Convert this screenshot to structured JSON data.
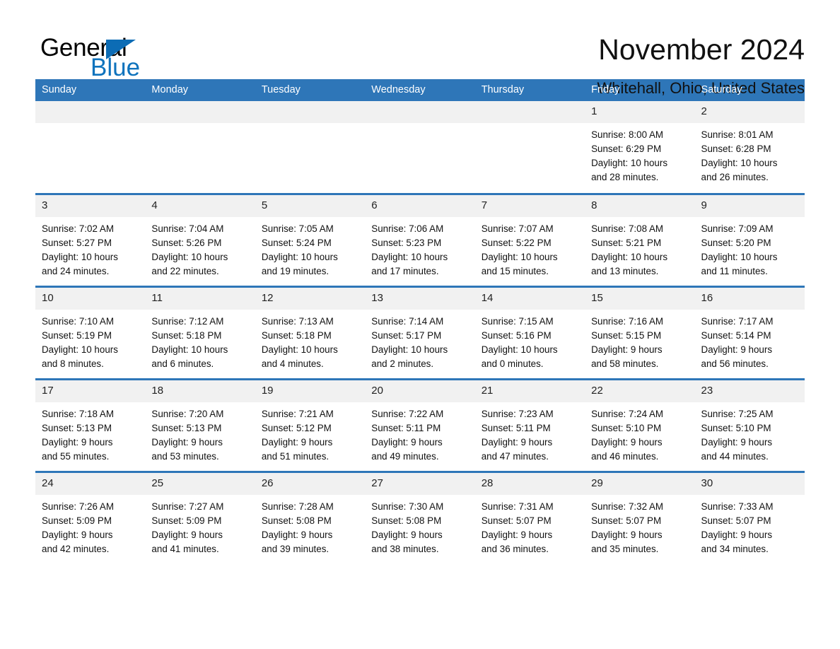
{
  "brand": {
    "name_part1": "General",
    "name_part2": "Blue",
    "triangle_color": "#0c6cb5",
    "blue_color": "#0f73bd"
  },
  "header": {
    "month_title": "November 2024",
    "location": "Whitehall, Ohio, United States"
  },
  "theme": {
    "header_blue": "#2e76b8",
    "daynum_gray": "#f1f1f1"
  },
  "calendar": {
    "weekdays": [
      "Sunday",
      "Monday",
      "Tuesday",
      "Wednesday",
      "Thursday",
      "Friday",
      "Saturday"
    ],
    "labels": {
      "sunrise_prefix": "Sunrise:",
      "sunset_prefix": "Sunset:",
      "daylight_prefix": "Daylight:"
    },
    "weeks": [
      [
        {
          "day": "",
          "empty": true
        },
        {
          "day": "",
          "empty": true
        },
        {
          "day": "",
          "empty": true
        },
        {
          "day": "",
          "empty": true
        },
        {
          "day": "",
          "empty": true
        },
        {
          "day": "1",
          "sunrise": "Sunrise: 8:00 AM",
          "sunset": "Sunset: 6:29 PM",
          "daylight_line1": "Daylight: 10 hours",
          "daylight_line2": "and 28 minutes."
        },
        {
          "day": "2",
          "sunrise": "Sunrise: 8:01 AM",
          "sunset": "Sunset: 6:28 PM",
          "daylight_line1": "Daylight: 10 hours",
          "daylight_line2": "and 26 minutes."
        }
      ],
      [
        {
          "day": "3",
          "sunrise": "Sunrise: 7:02 AM",
          "sunset": "Sunset: 5:27 PM",
          "daylight_line1": "Daylight: 10 hours",
          "daylight_line2": "and 24 minutes."
        },
        {
          "day": "4",
          "sunrise": "Sunrise: 7:04 AM",
          "sunset": "Sunset: 5:26 PM",
          "daylight_line1": "Daylight: 10 hours",
          "daylight_line2": "and 22 minutes."
        },
        {
          "day": "5",
          "sunrise": "Sunrise: 7:05 AM",
          "sunset": "Sunset: 5:24 PM",
          "daylight_line1": "Daylight: 10 hours",
          "daylight_line2": "and 19 minutes."
        },
        {
          "day": "6",
          "sunrise": "Sunrise: 7:06 AM",
          "sunset": "Sunset: 5:23 PM",
          "daylight_line1": "Daylight: 10 hours",
          "daylight_line2": "and 17 minutes."
        },
        {
          "day": "7",
          "sunrise": "Sunrise: 7:07 AM",
          "sunset": "Sunset: 5:22 PM",
          "daylight_line1": "Daylight: 10 hours",
          "daylight_line2": "and 15 minutes."
        },
        {
          "day": "8",
          "sunrise": "Sunrise: 7:08 AM",
          "sunset": "Sunset: 5:21 PM",
          "daylight_line1": "Daylight: 10 hours",
          "daylight_line2": "and 13 minutes."
        },
        {
          "day": "9",
          "sunrise": "Sunrise: 7:09 AM",
          "sunset": "Sunset: 5:20 PM",
          "daylight_line1": "Daylight: 10 hours",
          "daylight_line2": "and 11 minutes."
        }
      ],
      [
        {
          "day": "10",
          "sunrise": "Sunrise: 7:10 AM",
          "sunset": "Sunset: 5:19 PM",
          "daylight_line1": "Daylight: 10 hours",
          "daylight_line2": "and 8 minutes."
        },
        {
          "day": "11",
          "sunrise": "Sunrise: 7:12 AM",
          "sunset": "Sunset: 5:18 PM",
          "daylight_line1": "Daylight: 10 hours",
          "daylight_line2": "and 6 minutes."
        },
        {
          "day": "12",
          "sunrise": "Sunrise: 7:13 AM",
          "sunset": "Sunset: 5:18 PM",
          "daylight_line1": "Daylight: 10 hours",
          "daylight_line2": "and 4 minutes."
        },
        {
          "day": "13",
          "sunrise": "Sunrise: 7:14 AM",
          "sunset": "Sunset: 5:17 PM",
          "daylight_line1": "Daylight: 10 hours",
          "daylight_line2": "and 2 minutes."
        },
        {
          "day": "14",
          "sunrise": "Sunrise: 7:15 AM",
          "sunset": "Sunset: 5:16 PM",
          "daylight_line1": "Daylight: 10 hours",
          "daylight_line2": "and 0 minutes."
        },
        {
          "day": "15",
          "sunrise": "Sunrise: 7:16 AM",
          "sunset": "Sunset: 5:15 PM",
          "daylight_line1": "Daylight: 9 hours",
          "daylight_line2": "and 58 minutes."
        },
        {
          "day": "16",
          "sunrise": "Sunrise: 7:17 AM",
          "sunset": "Sunset: 5:14 PM",
          "daylight_line1": "Daylight: 9 hours",
          "daylight_line2": "and 56 minutes."
        }
      ],
      [
        {
          "day": "17",
          "sunrise": "Sunrise: 7:18 AM",
          "sunset": "Sunset: 5:13 PM",
          "daylight_line1": "Daylight: 9 hours",
          "daylight_line2": "and 55 minutes."
        },
        {
          "day": "18",
          "sunrise": "Sunrise: 7:20 AM",
          "sunset": "Sunset: 5:13 PM",
          "daylight_line1": "Daylight: 9 hours",
          "daylight_line2": "and 53 minutes."
        },
        {
          "day": "19",
          "sunrise": "Sunrise: 7:21 AM",
          "sunset": "Sunset: 5:12 PM",
          "daylight_line1": "Daylight: 9 hours",
          "daylight_line2": "and 51 minutes."
        },
        {
          "day": "20",
          "sunrise": "Sunrise: 7:22 AM",
          "sunset": "Sunset: 5:11 PM",
          "daylight_line1": "Daylight: 9 hours",
          "daylight_line2": "and 49 minutes."
        },
        {
          "day": "21",
          "sunrise": "Sunrise: 7:23 AM",
          "sunset": "Sunset: 5:11 PM",
          "daylight_line1": "Daylight: 9 hours",
          "daylight_line2": "and 47 minutes."
        },
        {
          "day": "22",
          "sunrise": "Sunrise: 7:24 AM",
          "sunset": "Sunset: 5:10 PM",
          "daylight_line1": "Daylight: 9 hours",
          "daylight_line2": "and 46 minutes."
        },
        {
          "day": "23",
          "sunrise": "Sunrise: 7:25 AM",
          "sunset": "Sunset: 5:10 PM",
          "daylight_line1": "Daylight: 9 hours",
          "daylight_line2": "and 44 minutes."
        }
      ],
      [
        {
          "day": "24",
          "sunrise": "Sunrise: 7:26 AM",
          "sunset": "Sunset: 5:09 PM",
          "daylight_line1": "Daylight: 9 hours",
          "daylight_line2": "and 42 minutes."
        },
        {
          "day": "25",
          "sunrise": "Sunrise: 7:27 AM",
          "sunset": "Sunset: 5:09 PM",
          "daylight_line1": "Daylight: 9 hours",
          "daylight_line2": "and 41 minutes."
        },
        {
          "day": "26",
          "sunrise": "Sunrise: 7:28 AM",
          "sunset": "Sunset: 5:08 PM",
          "daylight_line1": "Daylight: 9 hours",
          "daylight_line2": "and 39 minutes."
        },
        {
          "day": "27",
          "sunrise": "Sunrise: 7:30 AM",
          "sunset": "Sunset: 5:08 PM",
          "daylight_line1": "Daylight: 9 hours",
          "daylight_line2": "and 38 minutes."
        },
        {
          "day": "28",
          "sunrise": "Sunrise: 7:31 AM",
          "sunset": "Sunset: 5:07 PM",
          "daylight_line1": "Daylight: 9 hours",
          "daylight_line2": "and 36 minutes."
        },
        {
          "day": "29",
          "sunrise": "Sunrise: 7:32 AM",
          "sunset": "Sunset: 5:07 PM",
          "daylight_line1": "Daylight: 9 hours",
          "daylight_line2": "and 35 minutes."
        },
        {
          "day": "30",
          "sunrise": "Sunrise: 7:33 AM",
          "sunset": "Sunset: 5:07 PM",
          "daylight_line1": "Daylight: 9 hours",
          "daylight_line2": "and 34 minutes."
        }
      ]
    ]
  }
}
